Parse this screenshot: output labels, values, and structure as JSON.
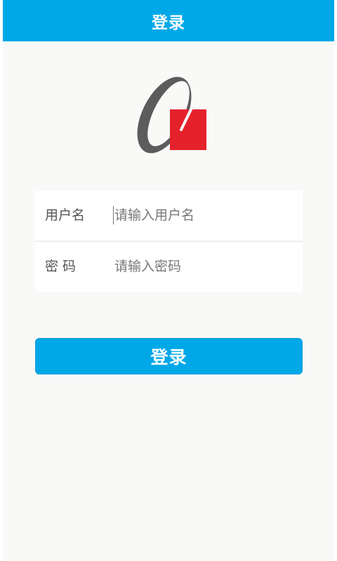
{
  "app_bar": {
    "title": "登录"
  },
  "logo": {
    "icon": "brand-logo",
    "colors": {
      "ring": "#5c5c5c",
      "square": "#e5212c"
    }
  },
  "form": {
    "username": {
      "label": "用户名",
      "placeholder": "请输入用户名",
      "value": ""
    },
    "password": {
      "label": "密 码",
      "placeholder": "请输入密码",
      "value": ""
    }
  },
  "login_button": {
    "label": "登录"
  },
  "colors": {
    "primary": "#00a8e8",
    "background": "#f9f9f8",
    "card": "#ffffff",
    "label_text": "#555555"
  }
}
